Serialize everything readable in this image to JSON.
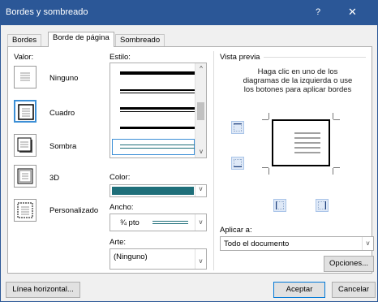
{
  "window": {
    "title": "Bordes y sombreado",
    "help_glyph": "?",
    "close_glyph": "✕"
  },
  "tabs": [
    {
      "label": "Bordes",
      "active": false
    },
    {
      "label": "Borde de página",
      "active": true
    },
    {
      "label": "Sombreado",
      "active": false
    }
  ],
  "setting": {
    "label": "Valor:",
    "options": [
      {
        "label": "Ninguno",
        "icon": "border-none-icon"
      },
      {
        "label": "Cuadro",
        "icon": "border-box-icon",
        "selected": true
      },
      {
        "label": "Sombra",
        "icon": "border-shadow-icon"
      },
      {
        "label": "3D",
        "icon": "border-3d-icon"
      },
      {
        "label": "Personalizado",
        "icon": "border-custom-icon"
      }
    ]
  },
  "style": {
    "label": "Estilo:",
    "scroll_up": "^",
    "scroll_down": "v"
  },
  "color": {
    "label": "Color:",
    "value_color": "#1f6f7a",
    "arrow": "v"
  },
  "width": {
    "label": "Ancho:",
    "value": "¾ pto",
    "line_color": "#1f6f7a",
    "arrow": "v"
  },
  "art": {
    "label": "Arte:",
    "value": "(Ninguno)",
    "arrow": "v"
  },
  "preview": {
    "label": "Vista previa",
    "hint_lines": [
      "Haga clic en uno de los",
      "diagramas de la izquierda o use",
      "los botones para aplicar bordes"
    ]
  },
  "apply_to": {
    "label": "Aplicar a:",
    "value": "Todo el documento",
    "arrow": "v"
  },
  "buttons": {
    "options": "Opciones...",
    "horizontal_line": "Línea horizontal...",
    "ok": "Aceptar",
    "cancel": "Cancelar"
  },
  "colors": {
    "titlebar": "#2b5797",
    "accent": "#3c8fd6"
  }
}
